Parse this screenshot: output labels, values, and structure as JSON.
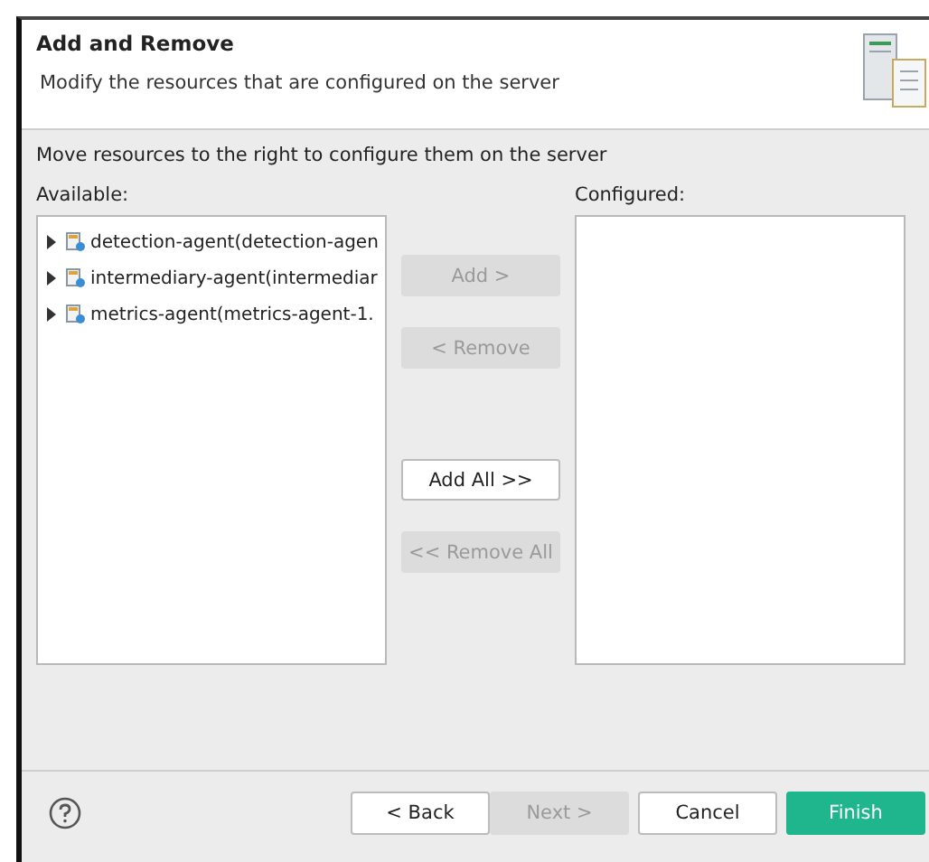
{
  "header": {
    "title": "Add and Remove",
    "subtitle": "Modify the resources that are configured on the server"
  },
  "instructions": "Move resources to the right to configure them on the server",
  "available": {
    "label": "Available:",
    "items": [
      {
        "label": "detection-agent(detection-agen",
        "expanded": false
      },
      {
        "label": "intermediary-agent(intermediar",
        "expanded": false
      },
      {
        "label": "metrics-agent(metrics-agent-1.",
        "expanded": false
      }
    ]
  },
  "move_buttons": [
    {
      "label": "Add >",
      "disabled": true
    },
    {
      "label": "< Remove",
      "disabled": true
    },
    {
      "label": "Add All >>",
      "disabled": false
    },
    {
      "label": "<< Remove All",
      "disabled": true
    }
  ],
  "configured": {
    "label": "Configured:"
  },
  "footer": {
    "buttons": [
      {
        "label": "< Back",
        "kind": "normal",
        "disabled": false
      },
      {
        "label": "Next >",
        "kind": "normal",
        "disabled": true
      },
      {
        "label": "Cancel",
        "kind": "normal",
        "disabled": false
      },
      {
        "label": "Finish",
        "kind": "primary",
        "disabled": false
      }
    ]
  }
}
